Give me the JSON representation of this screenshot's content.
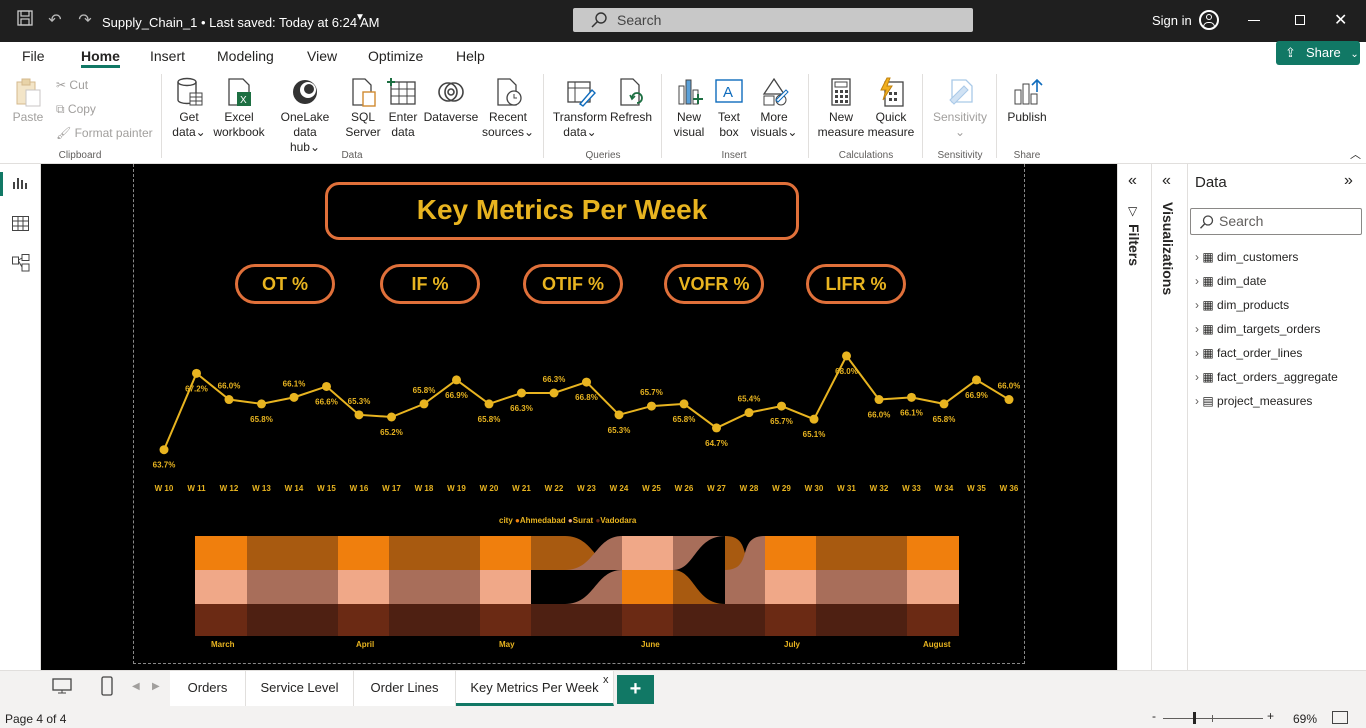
{
  "titlebar": {
    "file_title": "Supply_Chain_1 • Last saved: Today at 6:24 AM",
    "search_placeholder": "Search",
    "sign_in": "Sign in"
  },
  "menu": {
    "items": [
      "File",
      "Home",
      "Insert",
      "Modeling",
      "View",
      "Optimize",
      "Help"
    ],
    "active": "Home",
    "share_label": "Share"
  },
  "ribbon": {
    "clipboard": {
      "paste": "Paste",
      "cut": "Cut",
      "copy": "Copy",
      "format_painter": "Format painter",
      "group": "Clipboard"
    },
    "data": {
      "get_data": [
        "Get",
        "data"
      ],
      "excel": [
        "Excel",
        "workbook"
      ],
      "onelake": [
        "OneLake data",
        "hub"
      ],
      "sql": [
        "SQL",
        "Server"
      ],
      "enter": [
        "Enter",
        "data"
      ],
      "dataverse": "Dataverse",
      "recent": [
        "Recent",
        "sources"
      ],
      "group": "Data"
    },
    "queries": {
      "transform": [
        "Transform",
        "data"
      ],
      "refresh": "Refresh",
      "group": "Queries"
    },
    "insert": {
      "new_visual": [
        "New",
        "visual"
      ],
      "text_box": [
        "Text",
        "box"
      ],
      "more_visuals": [
        "More",
        "visuals"
      ],
      "group": "Insert"
    },
    "calculations": {
      "new_measure": [
        "New",
        "measure"
      ],
      "quick_measure": [
        "Quick",
        "measure"
      ],
      "group": "Calculations"
    },
    "sensitivity": {
      "label": "Sensitivity",
      "group": "Sensitivity"
    },
    "share": {
      "publish": "Publish",
      "group": "Share"
    }
  },
  "report": {
    "title": "Key Metrics Per Week",
    "pills": [
      "OT %",
      "IF %",
      "OTIF %",
      "VOFR %",
      "LIFR %"
    ],
    "ribbon_legend": {
      "title": "city",
      "items": [
        "Ahmedabad",
        "Surat",
        "Vadodara"
      ]
    },
    "ribbon_months": [
      "March",
      "April",
      "May",
      "June",
      "July",
      "August"
    ]
  },
  "chart_data": {
    "type": "line",
    "categories": [
      "W 10",
      "W 11",
      "W 12",
      "W 13",
      "W 14",
      "W 15",
      "W 16",
      "W 17",
      "W 18",
      "W 19",
      "W 20",
      "W 21",
      "W 22",
      "W 23",
      "W 24",
      "W 25",
      "W 26",
      "W 27",
      "W 28",
      "W 29",
      "W 30",
      "W 31",
      "W 32",
      "W 33",
      "W 34",
      "W 35",
      "W 36"
    ],
    "values": [
      63.7,
      67.2,
      66.0,
      65.8,
      66.1,
      66.6,
      65.3,
      65.2,
      65.8,
      66.9,
      65.8,
      66.3,
      66.3,
      66.8,
      65.3,
      65.7,
      65.8,
      64.7,
      65.4,
      65.7,
      65.1,
      68.0,
      66.0,
      66.1,
      65.8,
      66.9,
      66.0
    ],
    "labels": [
      "63.7%",
      "67.2%",
      "66.0%",
      "65.8%",
      "66.1%",
      "66.6%",
      "65.3%",
      "65.2%",
      "65.8%",
      "66.9%",
      "65.8%",
      "66.3%",
      "66.3%",
      "66.8%",
      "65.3%",
      "65.7%",
      "65.8%",
      "64.7%",
      "65.4%",
      "65.7%",
      "65.1%",
      "68.0%",
      "66.0%",
      "66.1%",
      "65.8%",
      "66.9%",
      "66.0%"
    ],
    "ylim": [
      63.0,
      68.5
    ],
    "grid": false,
    "line_color": "#e8b420"
  },
  "ribbon_chart": {
    "colors": {
      "Ahmedabad": "#f07f0d",
      "Surat": "#f0a888",
      "Vadodara": "#6b2a14"
    }
  },
  "pages": {
    "tabs": [
      "Orders",
      "Service Level",
      "Order Lines",
      "Key Metrics Per Week"
    ],
    "active": "Key Metrics Per Week"
  },
  "panes": {
    "filters": "Filters",
    "visualizations": "Visualizations",
    "data_title": "Data",
    "data_search": "Search",
    "tables": [
      "dim_customers",
      "dim_date",
      "dim_products",
      "dim_targets_orders",
      "fact_order_lines",
      "fact_orders_aggregate",
      "project_measures"
    ]
  },
  "status": {
    "page": "Page 4 of 4",
    "zoom": "69%"
  }
}
